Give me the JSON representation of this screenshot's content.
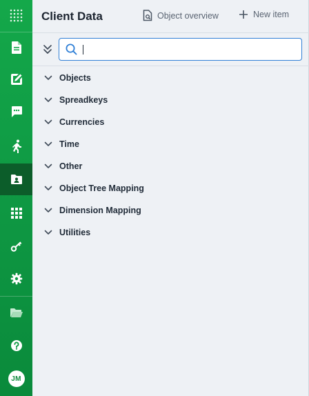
{
  "header": {
    "title": "Client Data",
    "object_overview_label": "Object overview",
    "new_item_label": "New item"
  },
  "search": {
    "value": "",
    "placeholder": ""
  },
  "sidebar": {
    "avatar_initials": "JM",
    "items": [
      {
        "icon": "app-launcher-grid-icon"
      },
      {
        "icon": "document-icon"
      },
      {
        "icon": "edit-note-icon"
      },
      {
        "icon": "chat-icon"
      },
      {
        "icon": "running-person-icon"
      },
      {
        "icon": "contact-folder-icon",
        "active": true
      },
      {
        "icon": "apps-grid-icon"
      },
      {
        "icon": "key-icon"
      },
      {
        "icon": "gear-icon"
      },
      {
        "icon": "folder-open-icon"
      },
      {
        "icon": "help-icon"
      }
    ]
  },
  "tree": {
    "items": [
      {
        "label": "Objects"
      },
      {
        "label": "Spreadkeys"
      },
      {
        "label": "Currencies"
      },
      {
        "label": "Time"
      },
      {
        "label": "Other"
      },
      {
        "label": "Object Tree Mapping"
      },
      {
        "label": "Dimension Mapping"
      },
      {
        "label": "Utilities"
      }
    ]
  },
  "colors": {
    "rail_green": "#14a84a",
    "rail_active": "#0c5d2a",
    "accent_blue": "#2f7fd6",
    "panel_bg": "#eef1f5"
  }
}
